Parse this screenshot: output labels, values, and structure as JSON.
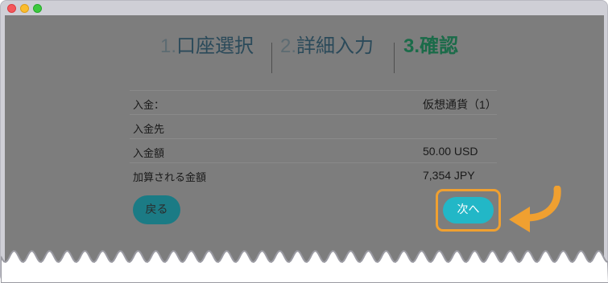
{
  "window": {
    "controls": [
      "close",
      "minimize",
      "zoom"
    ]
  },
  "steps": [
    {
      "num": "1.",
      "label": "口座選択",
      "active": false
    },
    {
      "num": "2.",
      "label": "詳細入力",
      "active": false
    },
    {
      "num": "3.",
      "label": "確認",
      "active": true
    }
  ],
  "details": [
    {
      "label": "入金：",
      "value": "仮想通貨（1）"
    },
    {
      "label": "入金先",
      "value": ""
    },
    {
      "label": "入金額",
      "value": "50.00 USD"
    },
    {
      "label": "加算される金額",
      "value": "7,354 JPY"
    }
  ],
  "buttons": {
    "back": "戻る",
    "next": "次へ"
  },
  "colors": {
    "highlight": "#f0a030",
    "next_button": "#22b7c7",
    "back_button": "#1b7b85",
    "active_step": "#1b6b49"
  },
  "icons": {
    "callout_arrow": "curved-arrow-icon"
  }
}
